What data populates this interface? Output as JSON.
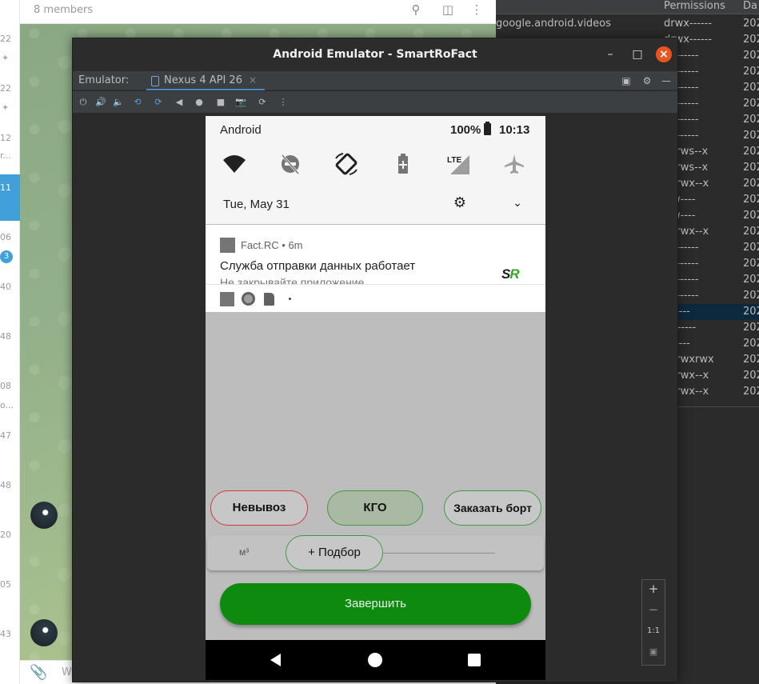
{
  "telegram": {
    "header": {
      "members": "8 members"
    },
    "list_times": [
      "22",
      "22",
      "12",
      "r...",
      "11",
      "06",
      "40",
      "48",
      "08",
      "o...",
      "47",
      "48",
      "20",
      "05",
      "43"
    ],
    "unread_badge": "3",
    "input_placeholder": "W"
  },
  "file_explorer": {
    "columns": {
      "permissions": "Permissions",
      "date": "Da"
    },
    "rows": [
      {
        "name": "google.android.videos",
        "perm": "drwx------",
        "date": "202"
      },
      {
        "name": "",
        "perm": "drwx------",
        "date": "202"
      },
      {
        "name": "",
        "perm": "vx------",
        "date": "202"
      },
      {
        "name": "",
        "perm": "vx------",
        "date": "202"
      },
      {
        "name": "",
        "perm": "vx------",
        "date": "202"
      },
      {
        "name": "",
        "perm": "vx------",
        "date": "202"
      },
      {
        "name": "",
        "perm": "vx------",
        "date": "202"
      },
      {
        "name": "",
        "perm": "vx------",
        "date": "202"
      },
      {
        "name": "",
        "perm": "vxrws--x",
        "date": "202"
      },
      {
        "name": "",
        "perm": "vxrws--x",
        "date": "202"
      },
      {
        "name": "",
        "perm": "vxrwx--x",
        "date": "202"
      },
      {
        "name": "",
        "perm": "-rw----",
        "date": "202"
      },
      {
        "name": "",
        "perm": "-rw----",
        "date": "202"
      },
      {
        "name": "",
        "perm": "vxrwx--x",
        "date": "202"
      },
      {
        "name": "",
        "perm": "vx------",
        "date": "202"
      },
      {
        "name": "",
        "perm": "vx------",
        "date": "202"
      },
      {
        "name": "",
        "perm": "vx------",
        "date": "202"
      },
      {
        "name": "",
        "perm": "vx------",
        "date": "202"
      },
      {
        "name": "",
        "perm": "-------",
        "date": "202",
        "selected": true
      },
      {
        "name": "",
        "perm": "v-------",
        "date": "202"
      },
      {
        "name": "",
        "perm": "-------",
        "date": "202"
      },
      {
        "name": "",
        "perm": "vxrwxrwx",
        "date": "202"
      },
      {
        "name": "",
        "perm": "vxrwx--x",
        "date": "202"
      },
      {
        "name": "",
        "perm": "vxrwx--x",
        "date": "202"
      }
    ]
  },
  "emulator": {
    "window_title": "Android Emulator - SmartRoFact",
    "label": "Emulator:",
    "tab": "Nexus 4 API 26",
    "zoom": {
      "in": "+",
      "out": "−",
      "one_to_one": "1:1"
    }
  },
  "android": {
    "status": {
      "carrier": "Android",
      "battery": "100%",
      "time": "10:13"
    },
    "shade_date": "Tue, May 31",
    "notification": {
      "app": "Fact.RC • 6m",
      "title": "Служба отправки данных работает",
      "text": "Не закрывайте приложение",
      "logo_s": "S",
      "logo_r": "R"
    },
    "mini_dot": "·",
    "buttons": {
      "nevyvoz": "Невывоз",
      "kgo": "КГО",
      "order": "Заказать борт",
      "podbor": "+ Подбор",
      "finish": "Завершить"
    },
    "m3_label": "м³"
  }
}
